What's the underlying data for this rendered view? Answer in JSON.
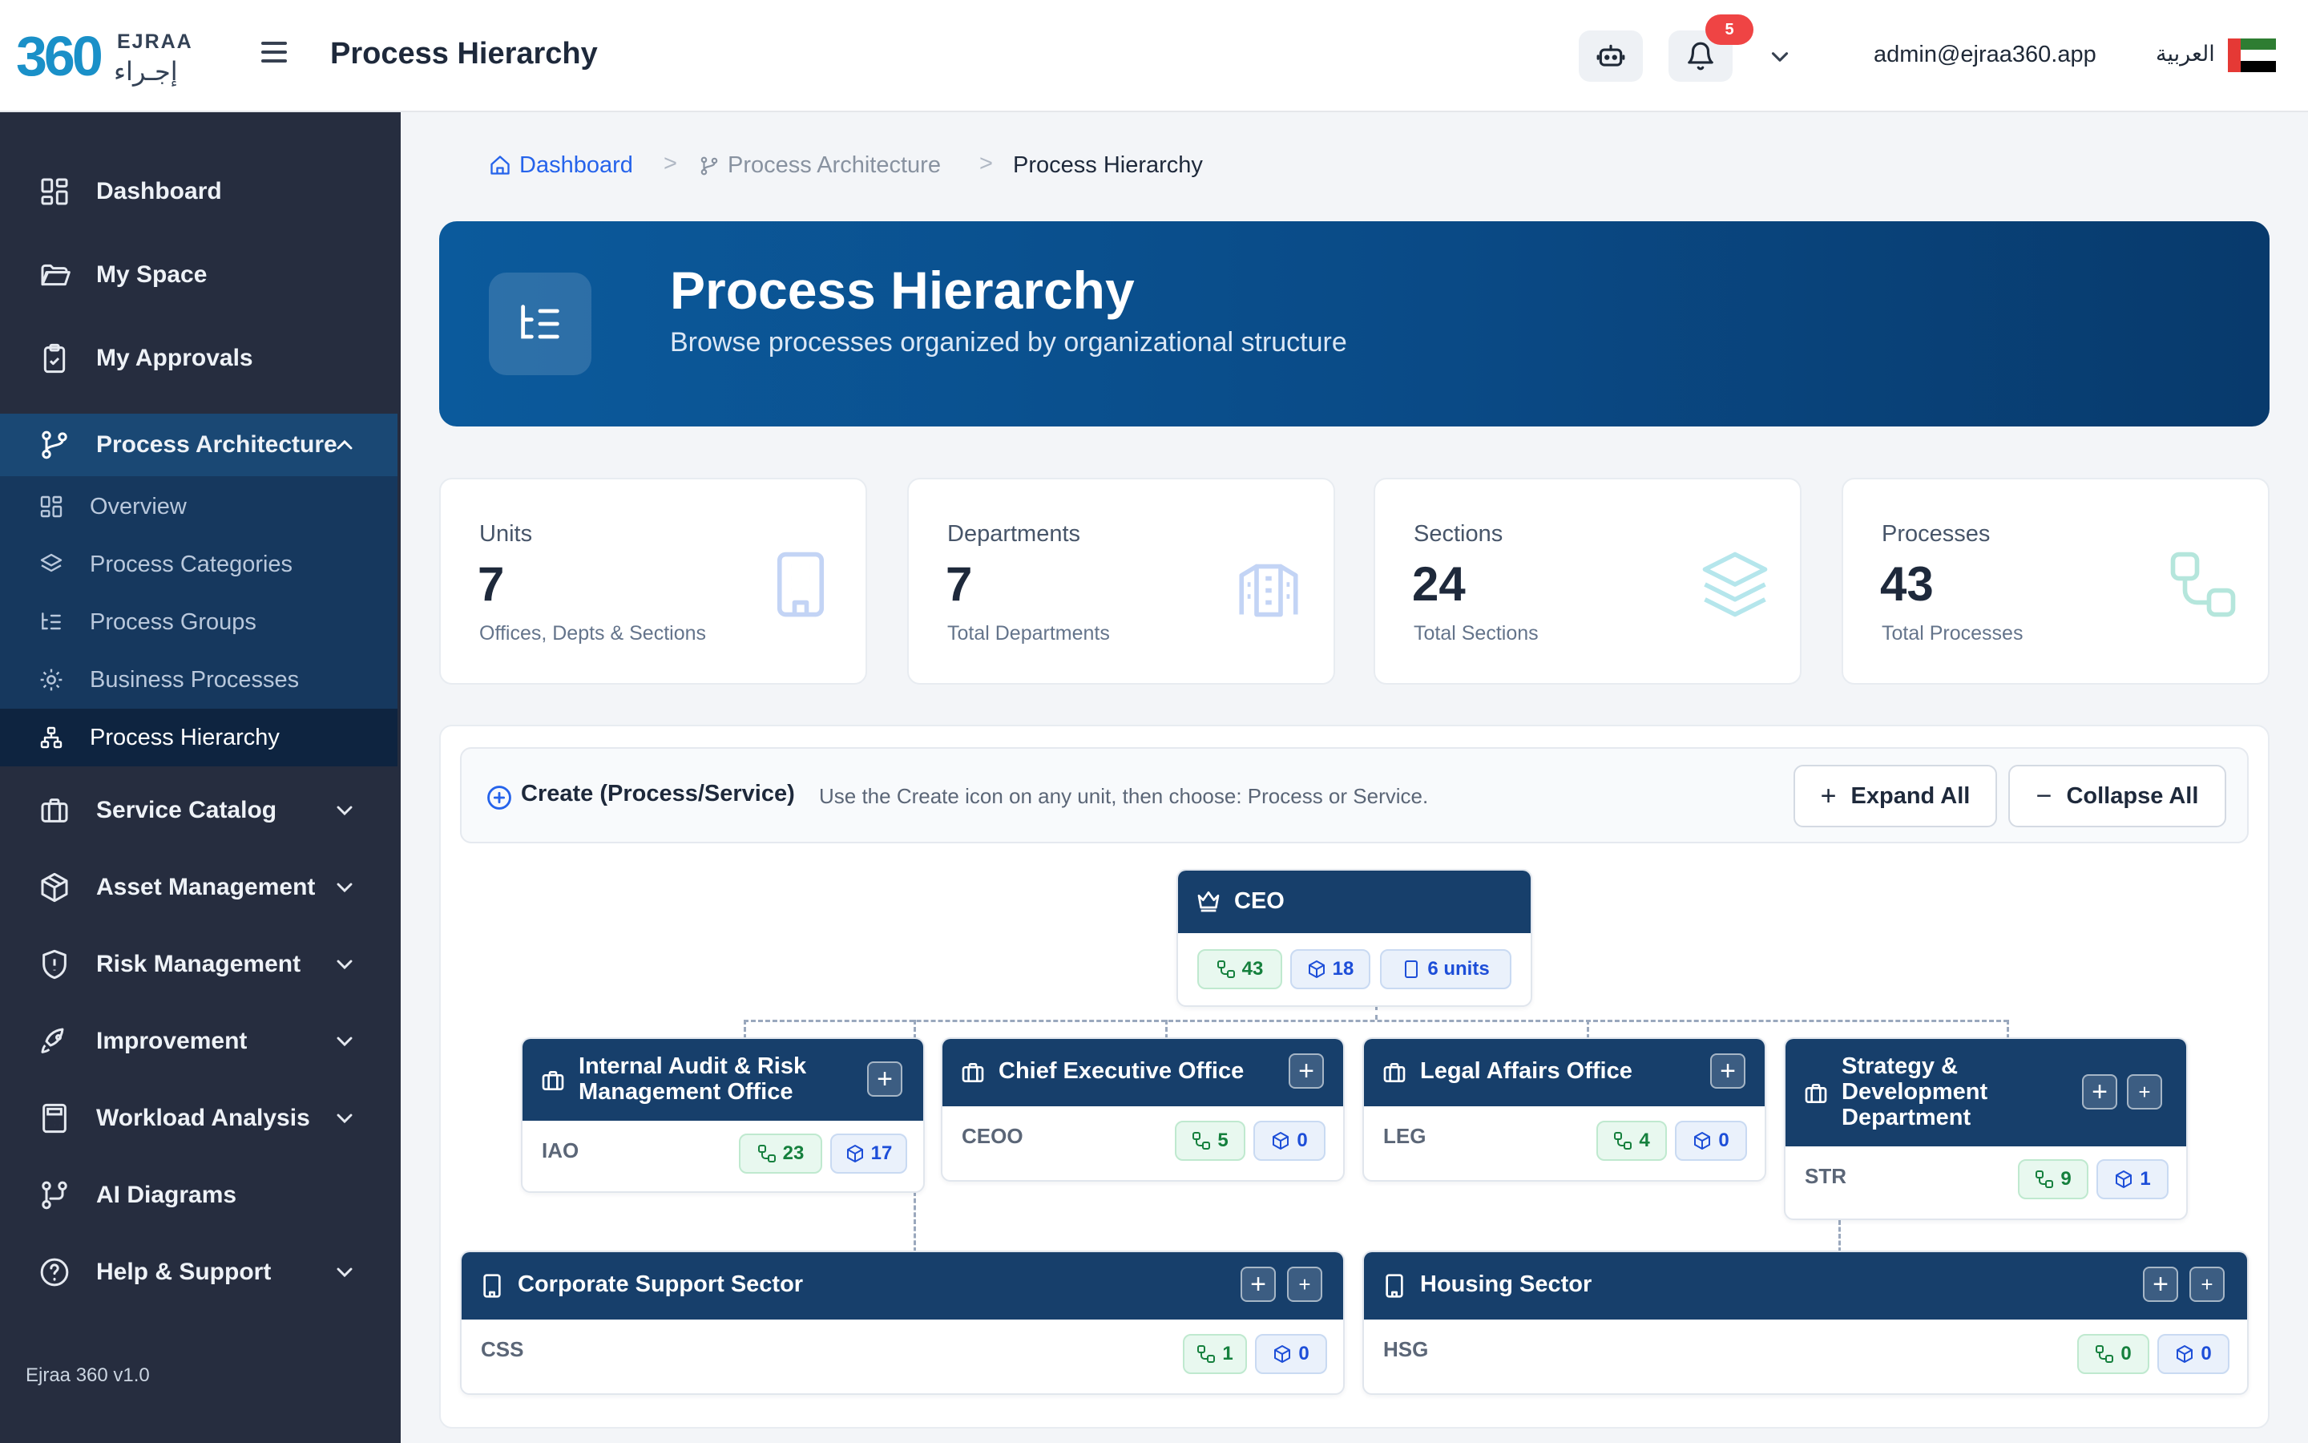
{
  "header": {
    "logo_number": "360",
    "logo_en": "EJRAA",
    "logo_ar": "إجـراء",
    "title": "Process Hierarchy",
    "notification_count": "5",
    "user_email": "admin@ejraa360.app",
    "language_label": "العربية"
  },
  "sidebar": {
    "items": [
      {
        "label": "Dashboard"
      },
      {
        "label": "My Space"
      },
      {
        "label": "My Approvals"
      },
      {
        "label": "Process Architecture"
      },
      {
        "label": "Service Catalog"
      },
      {
        "label": "Asset Management"
      },
      {
        "label": "Risk Management"
      },
      {
        "label": "Improvement"
      },
      {
        "label": "Workload Analysis"
      },
      {
        "label": "AI Diagrams"
      },
      {
        "label": "Help & Support"
      }
    ],
    "sub_items": [
      {
        "label": "Overview"
      },
      {
        "label": "Process Categories"
      },
      {
        "label": "Process Groups"
      },
      {
        "label": "Business Processes"
      },
      {
        "label": "Process Hierarchy"
      }
    ],
    "version": "Ejraa 360 v1.0"
  },
  "breadcrumb": {
    "home": "Dashboard",
    "parent": "Process Architecture",
    "current": "Process Hierarchy",
    "separator": ">"
  },
  "hero": {
    "title": "Process Hierarchy",
    "subtitle": "Browse processes organized by organizational structure"
  },
  "stats": [
    {
      "title": "Units",
      "value": "7",
      "subtitle": "Offices, Depts & Sections"
    },
    {
      "title": "Departments",
      "value": "7",
      "subtitle": "Total Departments"
    },
    {
      "title": "Sections",
      "value": "24",
      "subtitle": "Total Sections"
    },
    {
      "title": "Processes",
      "value": "43",
      "subtitle": "Total Processes"
    }
  ],
  "create_bar": {
    "label": "Create (Process/Service)",
    "hint": "Use the Create icon on any unit, then choose: Process or Service.",
    "expand_label": "Expand All",
    "collapse_label": "Collapse All"
  },
  "tree": {
    "root": {
      "name": "CEO",
      "processes": "43",
      "services": "18",
      "units": "6 units"
    },
    "level1": [
      {
        "name_line1": "Internal Audit & Risk",
        "name_line2": "Management Office",
        "code": "IAO",
        "processes": "23",
        "services": "17"
      },
      {
        "name": "Chief Executive Office",
        "code": "CEOO",
        "processes": "5",
        "services": "0"
      },
      {
        "name": "Legal Affairs Office",
        "code": "LEG",
        "processes": "4",
        "services": "0"
      },
      {
        "name_line1": "Strategy &",
        "name_line2": "Development",
        "name_line3": "Department",
        "code": "STR",
        "processes": "9",
        "services": "1"
      }
    ],
    "level2": [
      {
        "name": "Corporate Support Sector",
        "code": "CSS",
        "processes": "1",
        "services": "0"
      },
      {
        "name": "Housing Sector",
        "code": "HSG",
        "processes": "0",
        "services": "0"
      }
    ]
  },
  "colors": {
    "sidebar_bg": "#262d3f",
    "node_header": "#173f6b",
    "accent_blue": "#2563eb",
    "hero_start": "#0b5a9c",
    "hero_end": "#083a6c"
  }
}
